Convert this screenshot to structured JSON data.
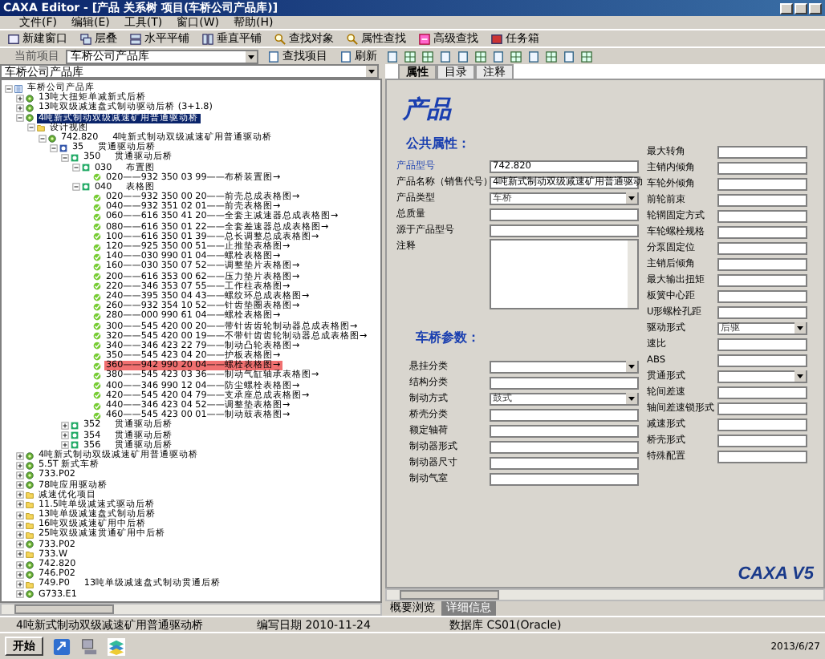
{
  "window": {
    "title": "CAXA Editor - [产品 关系树  项目(车桥公司产品库)]"
  },
  "menu": [
    "文件(F)",
    "编辑(E)",
    "工具(T)",
    "窗口(W)",
    "帮助(H)"
  ],
  "toolbar": [
    {
      "label": "新建窗口",
      "kind": "window"
    },
    {
      "label": "层叠",
      "kind": "cascade"
    },
    {
      "label": "水平平铺",
      "kind": "hsplit"
    },
    {
      "label": "垂直平铺",
      "kind": "vsplit"
    },
    {
      "label": "查找对象",
      "kind": "find"
    },
    {
      "label": "属性查找",
      "kind": "find"
    },
    {
      "label": "高级查找",
      "kind": "advanced"
    },
    {
      "label": "任务箱",
      "kind": "box"
    }
  ],
  "project_bar": {
    "label": "当前项目",
    "value": "车桥公司产品库",
    "buttons": [
      "查找项目",
      "刷新"
    ]
  },
  "tree": {
    "selector": "车桥公司产品库",
    "nodes": [
      {
        "label": "车桥公司产品库",
        "kind": "library",
        "selected": false,
        "marked": false,
        "expanded": true,
        "children": [
          {
            "label": "13吨大扭矩单减新式后桥",
            "kind": "gear",
            "selected": false,
            "marked": false,
            "expanded": false
          },
          {
            "label": "13吨双级减速盘式制动驱动后桥 (3+1.8)",
            "kind": "gear",
            "selected": false,
            "marked": false,
            "expanded": false
          },
          {
            "label": "4吨新式制动双级减速矿用普通驱动桥",
            "kind": "gear",
            "selected": true,
            "marked": false,
            "expanded": true,
            "children": [
              {
                "label": "设计视图",
                "kind": "folder",
                "selected": false,
                "marked": false,
                "expanded": true,
                "children": [
                  {
                    "label": "742.820",
                    "note": "4吨新式制动双级减速矿用普通驱动桥",
                    "kind": "gear",
                    "selected": false,
                    "marked": false,
                    "expanded": true,
                    "children": [
                      {
                        "label": "35",
                        "note": "贯通驱动后桥",
                        "kind": "part",
                        "selected": false,
                        "marked": false,
                        "expanded": true,
                        "children": [
                          {
                            "label": "350",
                            "note": "贯通驱动后桥",
                            "kind": "assembly",
                            "selected": false,
                            "marked": false,
                            "expanded": true,
                            "children": [
                              {
                                "label": "030",
                                "note": "布置图",
                                "kind": "assembly",
                                "selected": false,
                                "marked": false,
                                "expanded": true,
                                "children": [
                                  {
                                    "label": "020——932 350 03 99——布桥装置图→",
                                    "kind": "check",
                                    "selected": false,
                                    "marked": false
                                  }
                                ]
                              },
                              {
                                "label": "040",
                                "note": "表格图",
                                "kind": "assembly",
                                "selected": false,
                                "marked": false,
                                "expanded": true,
                                "children": [
                                  {
                                    "label": "020——932 350 00 20——前壳总成表格图→",
                                    "kind": "check",
                                    "selected": false,
                                    "marked": false
                                  },
                                  {
                                    "label": "040——932 351 02 01——前壳表格图→",
                                    "kind": "check",
                                    "selected": false,
                                    "marked": false
                                  },
                                  {
                                    "label": "060——616 350 41 20——全套主减速器总成表格图→",
                                    "kind": "check",
                                    "selected": false,
                                    "marked": false
                                  },
                                  {
                                    "label": "080——616 350 01 22——全套差速器总成表格图→",
                                    "kind": "check",
                                    "selected": false,
                                    "marked": false
                                  },
                                  {
                                    "label": "100——616 350 01 39——总长调整总成表格图→",
                                    "kind": "check",
                                    "selected": false,
                                    "marked": false
                                  },
                                  {
                                    "label": "120——925 350 00 51——止推垫表格图→",
                                    "kind": "check",
                                    "selected": false,
                                    "marked": false
                                  },
                                  {
                                    "label": "140——030 990 01 04——螺栓表格图→",
                                    "kind": "check",
                                    "selected": false,
                                    "marked": false
                                  },
                                  {
                                    "label": "160——030 350 07 52——调整垫片表格图→",
                                    "kind": "check",
                                    "selected": false,
                                    "marked": false
                                  },
                                  {
                                    "label": "200——616 353 00 62——压力垫片表格图→",
                                    "kind": "check",
                                    "selected": false,
                                    "marked": false
                                  },
                                  {
                                    "label": "220——346 353 07 55——工作柱表格图→",
                                    "kind": "check",
                                    "selected": false,
                                    "marked": false
                                  },
                                  {
                                    "label": "240——395 350 04 43——螺纹环总成表格图→",
                                    "kind": "check",
                                    "selected": false,
                                    "marked": false
                                  },
                                  {
                                    "label": "260——932 354 10 52——针齿垫圈表格图→",
                                    "kind": "check",
                                    "selected": false,
                                    "marked": false
                                  },
                                  {
                                    "label": "280——000 990 61 04——螺栓表格图→",
                                    "kind": "check",
                                    "selected": false,
                                    "marked": false
                                  },
                                  {
                                    "label": "300——545 420 00 20——带针齿齿轮制动器总成表格图→",
                                    "kind": "check",
                                    "selected": false,
                                    "marked": false
                                  },
                                  {
                                    "label": "320——545 420 00 19——不带针齿齿轮制动器总成表格图→",
                                    "kind": "check",
                                    "selected": false,
                                    "marked": false
                                  },
                                  {
                                    "label": "340——346 423 22 79——制动凸轮表格图→",
                                    "kind": "check",
                                    "selected": false,
                                    "marked": false
                                  },
                                  {
                                    "label": "350——545 423 04 20——护板表格图→",
                                    "kind": "check",
                                    "selected": false,
                                    "marked": false
                                  },
                                  {
                                    "label": "360——942 990 20 04——螺栓表格图→",
                                    "kind": "check",
                                    "selected": false,
                                    "marked": true
                                  },
                                  {
                                    "label": "380——545 423 03 36——制动气缸轴承表格图→",
                                    "kind": "check",
                                    "selected": false,
                                    "marked": false
                                  },
                                  {
                                    "label": "400——346 990 12 04——防尘螺栓表格图→",
                                    "kind": "check",
                                    "selected": false,
                                    "marked": false
                                  },
                                  {
                                    "label": "420——545 420 04 79——支承座总成表格图→",
                                    "kind": "check",
                                    "selected": false,
                                    "marked": false
                                  },
                                  {
                                    "label": "440——346 423 04 52——调整垫表格图→",
                                    "kind": "check",
                                    "selected": false,
                                    "marked": false
                                  },
                                  {
                                    "label": "460——545 423 00 01——制动鼓表格图→",
                                    "kind": "check",
                                    "selected": false,
                                    "marked": false
                                  }
                                ]
                              }
                            ]
                          },
                          {
                            "label": "352",
                            "note": "贯通驱动后桥",
                            "kind": "assembly",
                            "selected": false,
                            "marked": false,
                            "expanded": false
                          },
                          {
                            "label": "354",
                            "note": "贯通驱动后桥",
                            "kind": "assembly",
                            "selected": false,
                            "marked": false,
                            "expanded": false
                          },
                          {
                            "label": "356",
                            "note": "贯通驱动后桥",
                            "kind": "assembly",
                            "selected": false,
                            "marked": false,
                            "expanded": false
                          }
                        ]
                      }
                    ]
                  }
                ]
              }
            ]
          },
          {
            "label": "4吨新式制动双级减速矿用普通驱动桥",
            "kind": "gear",
            "selected": false,
            "marked": false,
            "expanded": false
          },
          {
            "label": "5.5T 新式车桥",
            "kind": "gear",
            "selected": false,
            "marked": false,
            "expanded": false
          },
          {
            "label": "733.P02",
            "kind": "gear",
            "selected": false,
            "marked": false,
            "expanded": false
          },
          {
            "label": "78吨应用驱动桥",
            "kind": "gear",
            "selected": false,
            "marked": false,
            "expanded": false
          },
          {
            "label": "减速优化项目",
            "kind": "folder",
            "selected": false,
            "marked": false,
            "expanded": false
          },
          {
            "label": "11.5吨单级减速式驱动后桥",
            "kind": "folder",
            "selected": false,
            "marked": false,
            "expanded": false
          },
          {
            "label": "13吨单级减速盘式制动后桥",
            "kind": "folder",
            "selected": false,
            "marked": false,
            "expanded": false
          },
          {
            "label": "16吨双级减速矿用中后桥",
            "kind": "folder",
            "selected": false,
            "marked": false,
            "expanded": false
          },
          {
            "label": "25吨双级减速贯通矿用中后桥",
            "kind": "folder",
            "selected": false,
            "marked": false,
            "expanded": false
          },
          {
            "label": "733.P02",
            "kind": "gear",
            "selected": false,
            "marked": false,
            "expanded": false
          },
          {
            "label": "733.W",
            "kind": "folder",
            "selected": false,
            "marked": false,
            "expanded": false
          },
          {
            "label": "742.820",
            "kind": "gear",
            "selected": false,
            "marked": false,
            "expanded": false
          },
          {
            "label": "746.P02",
            "kind": "gear",
            "selected": false,
            "marked": false,
            "expanded": false
          },
          {
            "label": "749.P0",
            "note": "13吨单级减速盘式制动贯通后桥",
            "kind": "folder",
            "selected": false,
            "marked": false,
            "expanded": false
          },
          {
            "label": "G733.E1",
            "kind": "gear",
            "selected": false,
            "marked": false,
            "expanded": false
          }
        ]
      }
    ]
  },
  "details": {
    "tabs": [
      {
        "label": "属性",
        "selected": true
      },
      {
        "label": "目录",
        "selected": false
      },
      {
        "label": "注释",
        "selected": false
      }
    ],
    "heading": "产品",
    "public_title": "公共属性：",
    "public_fields": [
      {
        "label": "产品型号",
        "value": "742.820",
        "kind": "text",
        "required": true
      },
      {
        "label": "产品名称（销售代号）",
        "value": "4吨新式制动双级减速矿用普通驱动",
        "kind": "text",
        "required": false
      },
      {
        "label": "产品类型",
        "value": "车桥",
        "kind": "select",
        "required": false
      },
      {
        "label": "总质量",
        "kind": "text",
        "required": false
      },
      {
        "label": "源于产品型号",
        "kind": "text",
        "required": false
      },
      {
        "label": "注释",
        "kind": "textarea",
        "required": false
      }
    ],
    "axle_title": "车桥参数：",
    "axle_fields": [
      {
        "label": "悬挂分类",
        "kind": "select"
      },
      {
        "label": "结构分类",
        "kind": "text"
      },
      {
        "label": "制动方式",
        "value": "鼓式",
        "kind": "select"
      },
      {
        "label": "桥壳分类",
        "kind": "text"
      },
      {
        "label": "额定轴荷",
        "kind": "text"
      },
      {
        "label": "制动器形式",
        "kind": "text"
      },
      {
        "label": "制动器尺寸",
        "kind": "text"
      },
      {
        "label": "制动气室",
        "kind": "text"
      }
    ],
    "side_fields": [
      {
        "label": "最大转角",
        "kind": "text"
      },
      {
        "label": "主销内倾角",
        "kind": "text"
      },
      {
        "label": "车轮外倾角",
        "kind": "text"
      },
      {
        "label": "前轮前束",
        "kind": "text"
      },
      {
        "label": "轮辋固定方式",
        "kind": "text"
      },
      {
        "label": "车轮螺栓规格",
        "kind": "text"
      },
      {
        "label": "分泵固定位",
        "kind": "text"
      },
      {
        "label": "主销后倾角",
        "kind": "text"
      },
      {
        "label": "最大输出扭矩",
        "kind": "text"
      },
      {
        "label": "板簧中心距",
        "kind": "text"
      },
      {
        "label": "U形螺栓孔距",
        "kind": "text"
      },
      {
        "label": "驱动形式",
        "value": "后驱",
        "kind": "select"
      },
      {
        "label": "速比",
        "kind": "text"
      },
      {
        "label": "ABS",
        "kind": "text"
      },
      {
        "label": "贯通形式",
        "kind": "select"
      },
      {
        "label": "轮间差速",
        "kind": "text"
      },
      {
        "label": "轴间差速锁形式",
        "kind": "text"
      },
      {
        "label": "减速形式",
        "kind": "text"
      },
      {
        "label": "桥壳形式",
        "kind": "text"
      },
      {
        "label": "特殊配置",
        "kind": "text"
      }
    ],
    "logo": "CAXA V5",
    "bottom_tabs": [
      {
        "label": "概要浏览",
        "selected": false
      },
      {
        "label": "详细信息",
        "selected": true
      }
    ]
  },
  "status_bar": [
    "4吨新式制动双级减速矿用普通驱动桥",
    "编写日期 2010-11-24",
    "数据库 CS01(Oracle)"
  ],
  "taskbar": {
    "start": "开始",
    "date": "2013/6/27"
  }
}
